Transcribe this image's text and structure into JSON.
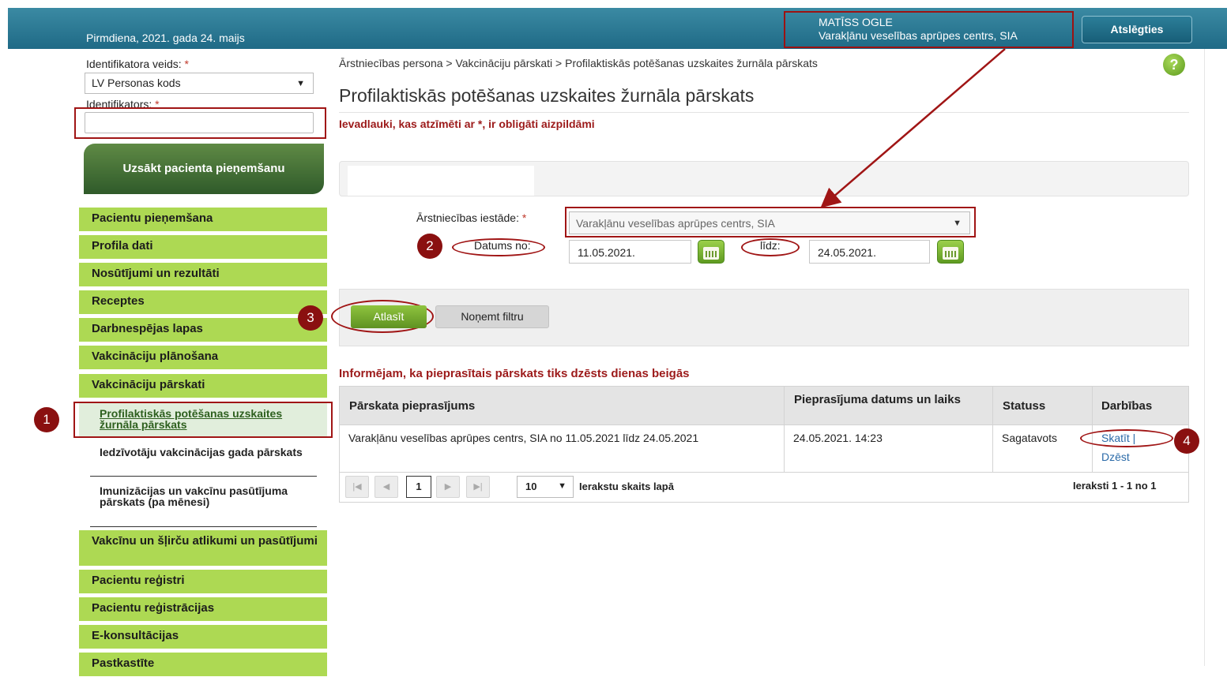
{
  "header": {
    "date": "Pirmdiena, 2021. gada 24. maijs",
    "user_name": "MATĪSS OGLE",
    "org_name": "Varakļānu veselības aprūpes centrs, SIA",
    "logout_label": "Atslēgties"
  },
  "sidebar": {
    "id_type_label": "Identifikatora veids:",
    "id_type_value": "LV Personas kods",
    "id_label": "Identifikators:",
    "required_mark": "*",
    "start_button": "Uzsākt pacienta pieņemšanu",
    "nav": [
      "Pacientu pieņemšana",
      "Profila dati",
      "Nosūtījumi un rezultāti",
      "Receptes",
      "Darbnespējas lapas",
      "Vakcināciju plānošana",
      "Vakcināciju pārskati"
    ],
    "sub": [
      "Profilaktiskās potēšanas uzskaites žurnāla pārskats",
      "Iedzīvotāju vakcinācijas gada pārskats",
      "Imunizācijas un vakcīnu pasūtījuma pārskats (pa mēnesi)"
    ],
    "nav_bottom": [
      "Vakcīnu un šļirču atlikumi un pasūtījumi",
      "Pacientu reģistri",
      "Pacientu reģistrācijas",
      "E-konsultācijas",
      "Pastkastīte"
    ]
  },
  "main": {
    "breadcrumb": "Ārstniecības persona > Vakcināciju pārskati > Profilaktiskās potēšanas uzskaites žurnāla pārskats",
    "help": "?",
    "title": "Profilaktiskās potēšanas uzskaites žurnāla pārskats",
    "required_note": "Ievadlauki, kas atzīmēti ar *, ir obligāti aizpildāmi",
    "institution_label": "Ārstniecības iestāde:",
    "institution_value": "Varakļānu veselības aprūpes centrs, SIA",
    "date_from_label": "Datums no:",
    "date_from": "11.05.2021.",
    "date_to_label": "līdz:",
    "date_to": "24.05.2021.",
    "filter_button": "Atlasīt",
    "clear_button": "Noņemt filtru",
    "info_note": "Informējam, ka pieprasītais pārskats tiks dzēsts dienas beigās",
    "table": {
      "headers": [
        "Pārskata pieprasījums",
        "Pieprasījuma datums un laiks",
        "Statuss",
        "Darbības"
      ],
      "rows": [
        {
          "request": "Varakļānu veselības aprūpes centrs, SIA no 11.05.2021 līdz 24.05.2021",
          "datetime": "24.05.2021. 14:23",
          "status": "Sagatavots",
          "view": "Skatīt |",
          "delete": "Dzēst"
        }
      ]
    },
    "pager": {
      "page": "1",
      "page_size": "10",
      "page_size_label": "Ierakstu skaits lapā",
      "summary": "Ieraksti 1 - 1 no 1"
    }
  },
  "annotations": [
    "1",
    "2",
    "3",
    "4"
  ]
}
